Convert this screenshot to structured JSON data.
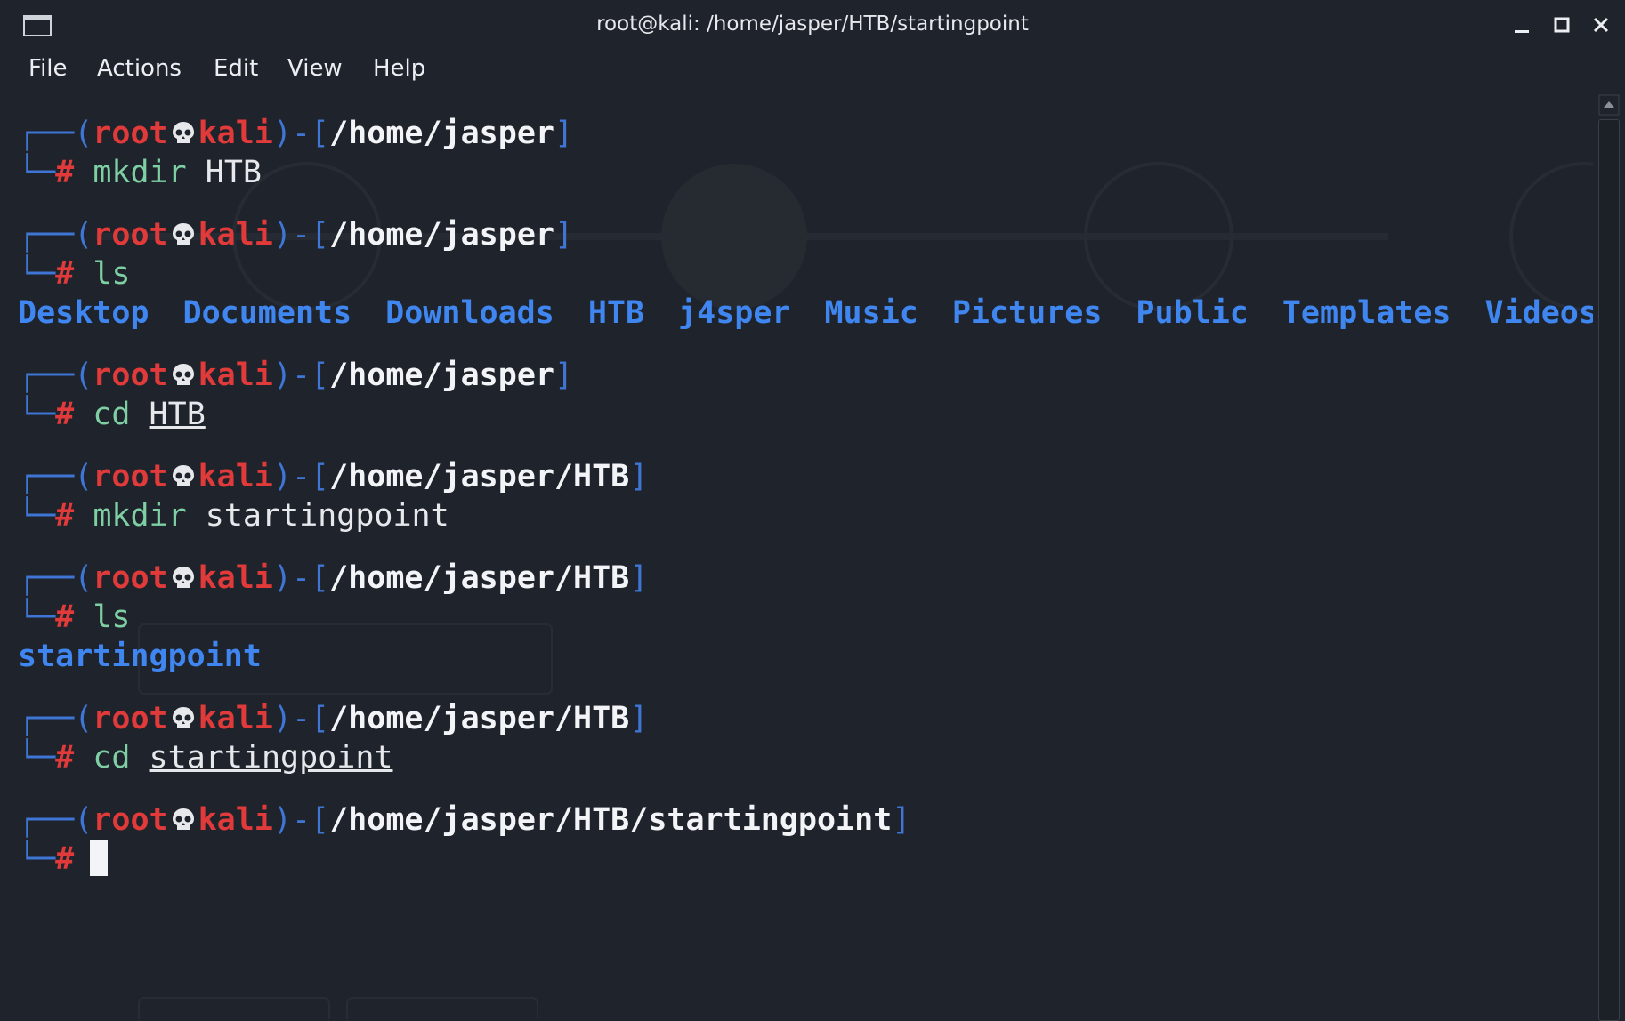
{
  "window": {
    "title": "root@kali: /home/jasper/HTB/startingpoint",
    "icons": [
      "terminal-icon",
      "minimize-icon",
      "maximize-icon",
      "close-icon"
    ]
  },
  "menu": [
    "File",
    "Actions",
    "Edit",
    "View",
    "Help"
  ],
  "colors": {
    "background": "#1f232b",
    "prompt_user": "#e03a3a",
    "prompt_frame": "#3f75d4",
    "directory": "#3f86f0",
    "command": "#7ecfa3",
    "text": "#f2f4f7"
  },
  "prompt": {
    "user": "root",
    "host": "kali",
    "hash": "#"
  },
  "blocks": [
    {
      "path": "/home/jasper",
      "cmd": "mkdir",
      "arg": "HTB",
      "arg_underlined": false,
      "output": []
    },
    {
      "path": "/home/jasper",
      "cmd": "ls",
      "arg": "",
      "arg_underlined": false,
      "output": [
        "Desktop",
        "Documents",
        "Downloads",
        "HTB",
        "j4sper",
        "Music",
        "Pictures",
        "Public",
        "Templates",
        "Videos"
      ]
    },
    {
      "path": "/home/jasper",
      "cmd": "cd",
      "arg": "HTB",
      "arg_underlined": true,
      "output": []
    },
    {
      "path": "/home/jasper/HTB",
      "cmd": "mkdir",
      "arg": "startingpoint",
      "arg_underlined": false,
      "output": []
    },
    {
      "path": "/home/jasper/HTB",
      "cmd": "ls",
      "arg": "",
      "arg_underlined": false,
      "output": [
        "startingpoint"
      ]
    },
    {
      "path": "/home/jasper/HTB",
      "cmd": "cd",
      "arg": "startingpoint",
      "arg_underlined": true,
      "output": []
    },
    {
      "path": "/home/jasper/HTB/startingpoint",
      "cmd": "",
      "arg": "",
      "arg_underlined": false,
      "output": [],
      "active": true
    }
  ]
}
